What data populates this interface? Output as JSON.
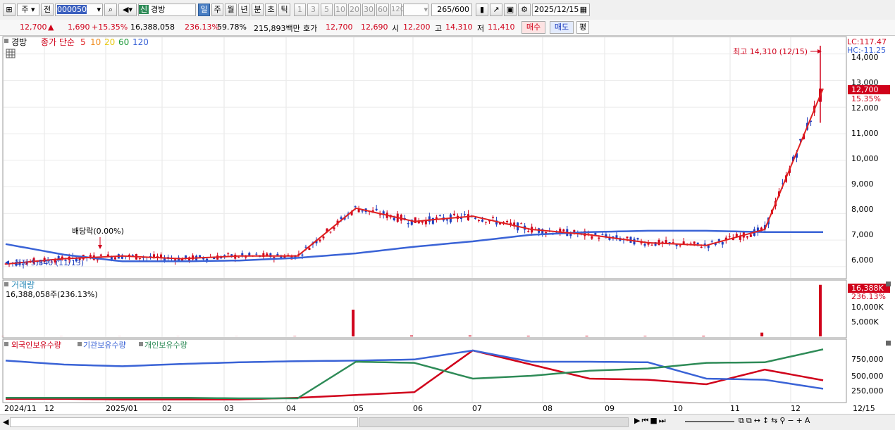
{
  "toolbar": {
    "period_type": "주",
    "prev_label": "전",
    "stock_code": "000050",
    "badge_new": "신",
    "stock_name": "경방",
    "intervals": [
      "일",
      "주",
      "월",
      "년",
      "분",
      "초",
      "틱"
    ],
    "active_interval": "일",
    "minute_options": [
      "1",
      "3",
      "5",
      "10",
      "20",
      "30",
      "60",
      "120"
    ],
    "count_value": "265",
    "count_max": "/600",
    "date": "2025/12/15"
  },
  "quote": {
    "price": "12,700",
    "change": "1,690",
    "change_pct": "+15.35%",
    "volume": "16,388,058",
    "volume_ratio": "236.13%",
    "turnover": "59.78%",
    "amount": "215,893백만",
    "bid_label": "호가",
    "bid1": "12,700",
    "bid2": "12,690",
    "open_label": "시",
    "open": "12,200",
    "high_label": "고",
    "high": "14,310",
    "low_label": "저",
    "low": "11,410",
    "buy_label": "매수",
    "sell_label": "매도",
    "avg_label": "평"
  },
  "price_panel": {
    "name": "경방",
    "ma_label": "종가 단순",
    "ma_periods": [
      "5",
      "10",
      "20",
      "60",
      "120"
    ],
    "high_annotation": "최고 14,310 (12/15)",
    "low_annotation": "최저 5,840 (11/13)",
    "dividend_annotation": "배당락(0.00%)",
    "lc": "LC:117.47",
    "hc": "HC:-11.25",
    "last_price_tag": "12,700",
    "last_pct_tag": "15.35%",
    "y_ticks": [
      "14,000",
      "13,000",
      "12,000",
      "11,000",
      "10,000",
      "9,000",
      "8,000",
      "7,000",
      "6,000"
    ]
  },
  "volume_panel": {
    "title": "거래량",
    "info": "16,388,058주(236.13%)",
    "tag": "16,388K",
    "tag_pct": "236.13%",
    "y_ticks": [
      "10,000K",
      "5,000K"
    ]
  },
  "holdings_panel": {
    "series": [
      "외국인보유수량",
      "기관보유수량",
      "개인보유수량"
    ],
    "y_ticks": [
      "750,000",
      "500,000",
      "250,000"
    ]
  },
  "x_axis": {
    "labels": [
      "2024/11",
      "12",
      "2025/01",
      "02",
      "03",
      "04",
      "05",
      "06",
      "07",
      "08",
      "09",
      "10",
      "11",
      "12"
    ],
    "end_label": "12/15"
  },
  "colors": {
    "up": "#d0021b",
    "down": "#1f3fbf",
    "ma5": "#e02020",
    "ma10": "#f08c1e",
    "ma20": "#f5e21a",
    "ma60": "#1e9a3a",
    "ma120": "#3a63d6",
    "foreign": "#d0021b",
    "institution": "#3a63d6",
    "individual": "#2e8b57"
  },
  "chart_data": [
    {
      "type": "candlestick",
      "title": "경방",
      "x": [
        "2024/11",
        "2024/12",
        "2025/01",
        "2025/02",
        "2025/03",
        "2025/04",
        "2025/05",
        "2025/06",
        "2025/07",
        "2025/08",
        "2025/09",
        "2025/10",
        "2025/11",
        "2025/12",
        "2025/12/15"
      ],
      "series": [
        {
          "name": "5",
          "values": [
            6100,
            6300,
            6400,
            6300,
            6400,
            6400,
            8200,
            7700,
            7900,
            7400,
            7200,
            6900,
            6800,
            7400,
            12700
          ]
        },
        {
          "name": "120",
          "values": [
            6850,
            6450,
            6200,
            6200,
            6230,
            6330,
            6500,
            6750,
            6950,
            7200,
            7300,
            7350,
            7350,
            7300,
            7300
          ]
        }
      ],
      "ylim": [
        5600,
        14600
      ],
      "annotations": [
        "최고 14,310 (12/15)",
        "최저 5,840 (11/13)",
        "배당락(0.00%)"
      ]
    },
    {
      "type": "bar",
      "title": "거래량",
      "x": [
        "2024/11",
        "2024/12",
        "2025/01",
        "2025/02",
        "2025/03",
        "2025/04",
        "2025/05",
        "2025/06",
        "2025/07",
        "2025/08",
        "2025/09",
        "2025/10",
        "2025/11",
        "2025/12",
        "2025/12/15"
      ],
      "values": [
        50,
        30,
        30,
        30,
        30,
        100,
        8500,
        300,
        300,
        200,
        200,
        150,
        200,
        1200,
        16388
      ],
      "unit": "K"
    },
    {
      "type": "line",
      "x": [
        "2024/11",
        "2024/12",
        "2025/01",
        "2025/02",
        "2025/03",
        "2025/04",
        "2025/05",
        "2025/06",
        "2025/07",
        "2025/08",
        "2025/09",
        "2025/10",
        "2025/11",
        "2025/12",
        "2025/12/15"
      ],
      "series": [
        {
          "name": "외국인보유수량",
          "values": [
            40000,
            40000,
            30000,
            30000,
            30000,
            60000,
            110000,
            160000,
            900000,
            650000,
            400000,
            380000,
            300000,
            560000,
            370000
          ]
        },
        {
          "name": "기관보유수량",
          "values": [
            720000,
            650000,
            620000,
            660000,
            690000,
            710000,
            720000,
            740000,
            900000,
            700000,
            700000,
            690000,
            400000,
            380000,
            220000
          ]
        },
        {
          "name": "개인보유수량",
          "values": [
            60000,
            60000,
            60000,
            60000,
            50000,
            50000,
            700000,
            680000,
            400000,
            450000,
            540000,
            580000,
            680000,
            690000,
            920000
          ]
        }
      ]
    }
  ]
}
